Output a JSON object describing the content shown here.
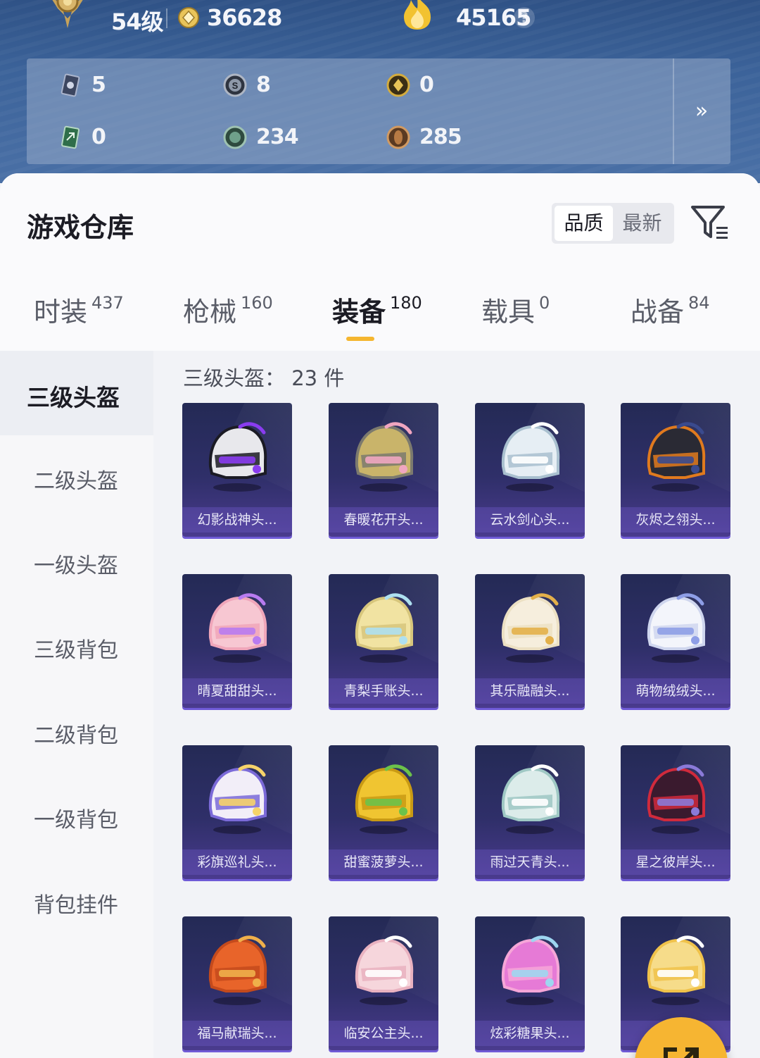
{
  "header": {
    "level": "54级",
    "coins": "36628",
    "popularity": "45165",
    "help": "?",
    "icons": {
      "rank": "gold-rank-emblem",
      "coin": "coin-icon",
      "flame": "flame-icon"
    }
  },
  "currencies": [
    {
      "value": "5",
      "icon": "silver-card-icon"
    },
    {
      "value": "8",
      "icon": "silver-s-coin-icon"
    },
    {
      "value": "0",
      "icon": "gold-token-icon"
    },
    {
      "value": "0",
      "icon": "green-card-icon"
    },
    {
      "value": "234",
      "icon": "green-coin-icon"
    },
    {
      "value": "285",
      "icon": "bronze-coin-icon"
    }
  ],
  "expand_label": "»",
  "page_title": "游戏仓库",
  "sort": {
    "options": [
      "品质",
      "最新"
    ],
    "selected": "品质"
  },
  "tabs": [
    {
      "label": "时装",
      "count": "437"
    },
    {
      "label": "枪械",
      "count": "160"
    },
    {
      "label": "装备",
      "count": "180",
      "active": true
    },
    {
      "label": "载具",
      "count": "0"
    },
    {
      "label": "战备",
      "count": "84"
    }
  ],
  "sidebar": {
    "items": [
      {
        "label": "三级头盔",
        "active": true
      },
      {
        "label": "二级头盔"
      },
      {
        "label": "一级头盔"
      },
      {
        "label": "三级背包"
      },
      {
        "label": "二级背包"
      },
      {
        "label": "一级背包"
      },
      {
        "label": "背包挂件"
      }
    ]
  },
  "section_title": "三级头盔：  23 件",
  "items": [
    {
      "name": "幻影战神头...",
      "colors": [
        "#e8e8ec",
        "#1b1b24",
        "#8a3cf0"
      ]
    },
    {
      "name": "春暖花开头...",
      "colors": [
        "#c9b46a",
        "#7c7a6e",
        "#f0a6c0"
      ]
    },
    {
      "name": "云水剑心头...",
      "colors": [
        "#e6eef4",
        "#a9c0cf",
        "#ffffff"
      ]
    },
    {
      "name": "灰烬之翎头...",
      "colors": [
        "#2a2a34",
        "#e07a1e",
        "#3a4a8e"
      ]
    },
    {
      "name": "晴夏甜甜头...",
      "colors": [
        "#f7c7d2",
        "#f0a6ba",
        "#b87bf0"
      ]
    },
    {
      "name": "青梨手账头...",
      "colors": [
        "#f1e3a2",
        "#d7c67c",
        "#aee0f0"
      ]
    },
    {
      "name": "其乐融融头...",
      "colors": [
        "#f6eedd",
        "#ece0c3",
        "#e3b04a"
      ]
    },
    {
      "name": "萌物绒绒头...",
      "colors": [
        "#f3f5fb",
        "#cfd6ee",
        "#8e9ee6"
      ]
    },
    {
      "name": "彩旗巡礼头...",
      "colors": [
        "#f2eef8",
        "#7b6ad8",
        "#f6d36a"
      ]
    },
    {
      "name": "甜蜜菠萝头...",
      "colors": [
        "#f0c531",
        "#c99a14",
        "#6cc24a"
      ]
    },
    {
      "name": "雨过天青头...",
      "colors": [
        "#dcecea",
        "#9fc8c4",
        "#ffffff"
      ]
    },
    {
      "name": "星之彼岸头...",
      "colors": [
        "#3a1a2e",
        "#d02a3c",
        "#8a7ad8"
      ]
    },
    {
      "name": "福马献瑞头...",
      "colors": [
        "#e8642a",
        "#c44a1c",
        "#f0b04a"
      ]
    },
    {
      "name": "临安公主头...",
      "colors": [
        "#f6d6dc",
        "#e9b2c0",
        "#ffffff"
      ]
    },
    {
      "name": "炫彩糖果头...",
      "colors": [
        "#e67ad6",
        "#f6a6d8",
        "#9ed6f0"
      ]
    },
    {
      "name": "萌",
      "colors": [
        "#f6dc8a",
        "#f0c24a",
        "#ffffff"
      ]
    }
  ],
  "fab": {
    "icon": "share-expand-icon"
  }
}
